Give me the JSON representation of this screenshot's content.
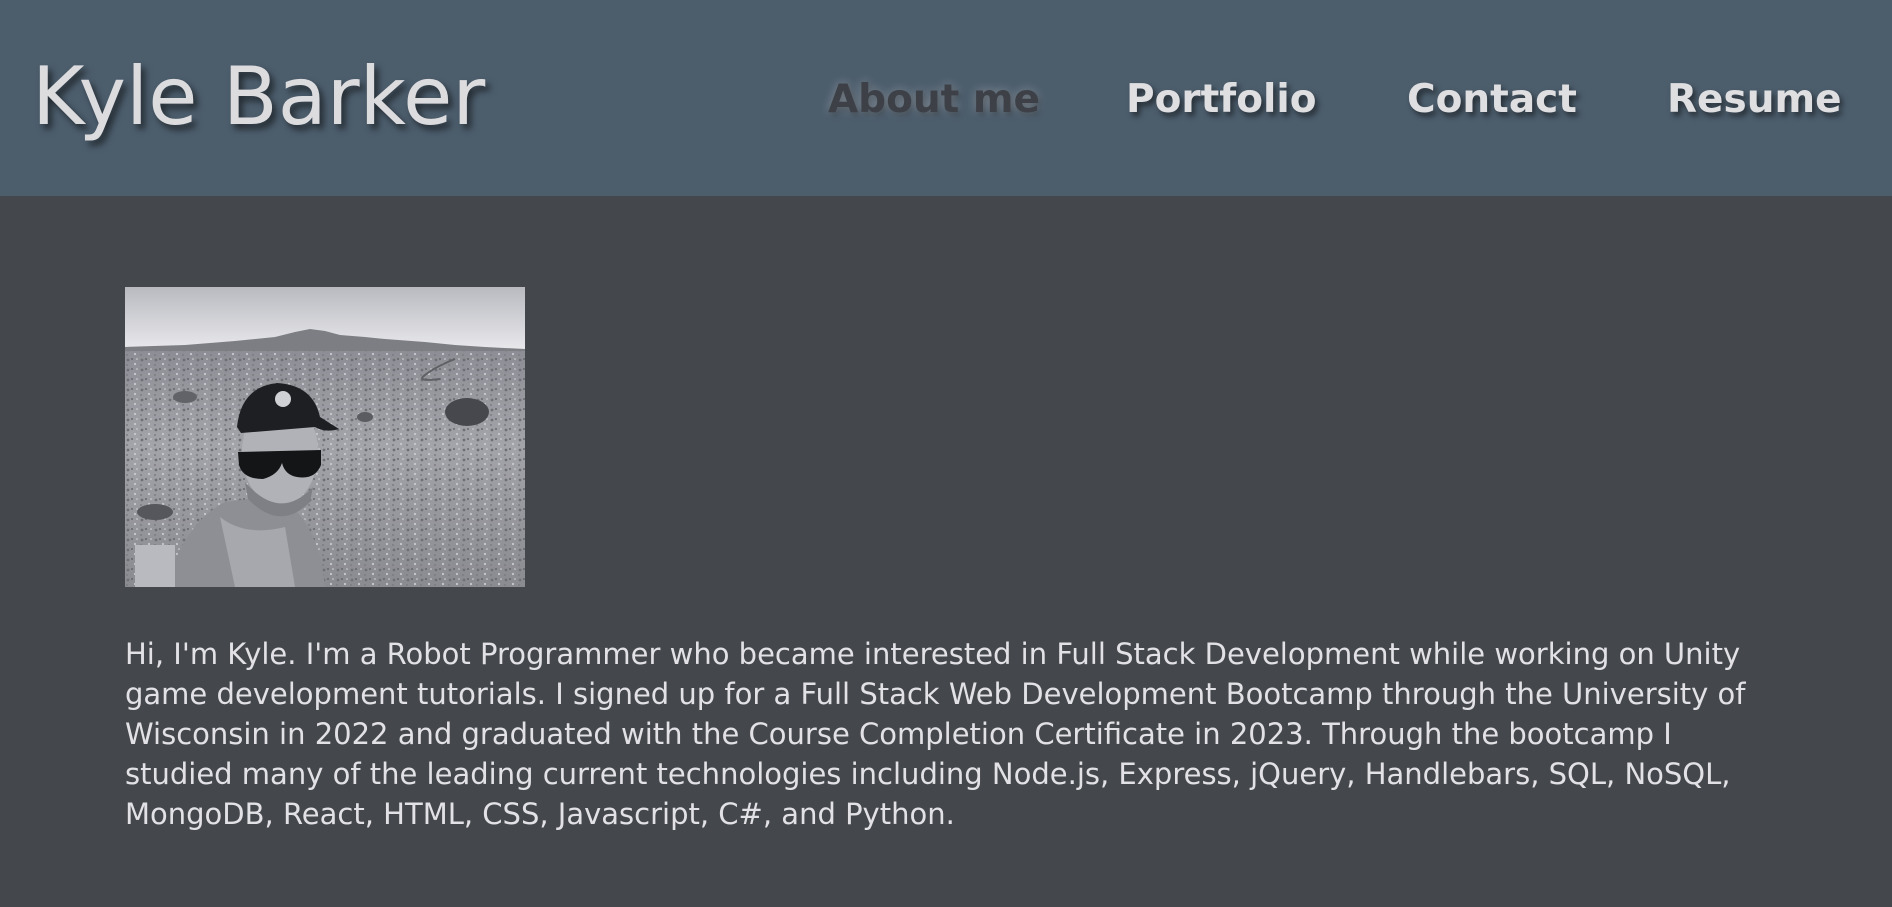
{
  "header": {
    "title": "Kyle Barker",
    "background_color": "#4c5d6c"
  },
  "nav": {
    "items": [
      {
        "label": "About me",
        "active": true
      },
      {
        "label": "Portfolio",
        "active": false
      },
      {
        "label": "Contact",
        "active": false
      },
      {
        "label": "Resume",
        "active": false
      }
    ]
  },
  "about": {
    "photo_alt": "profile-photo",
    "bio": "Hi, I'm Kyle. I'm a Robot Programmer who became interested in Full Stack Development while working on Unity game development tutorials. I signed up for a Full Stack Web Development Bootcamp through the University of Wisconsin in 2022 and graduated with the Course Completion Certificate in 2023. Through the bootcamp I studied many of the leading current technologies including Node.js, Express, jQuery, Handlebars, SQL, NoSQL, MongoDB, React, HTML, CSS, Javascript, C#, and Python."
  },
  "colors": {
    "page_background": "#44474b",
    "text": "#e2e2e6",
    "active_nav": "#3d4147"
  }
}
